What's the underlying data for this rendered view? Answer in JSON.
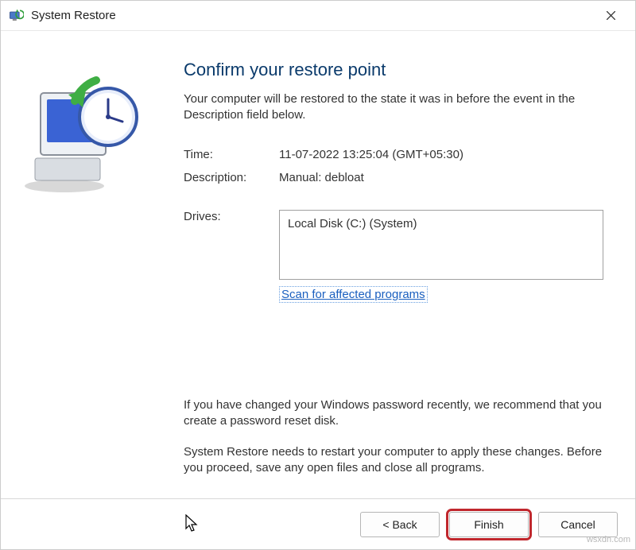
{
  "window": {
    "title": "System Restore"
  },
  "page": {
    "heading": "Confirm your restore point",
    "intro": "Your computer will be restored to the state it was in before the event in the Description field below."
  },
  "fields": {
    "time_label": "Time:",
    "time_value": "11-07-2022 13:25:04 (GMT+05:30)",
    "description_label": "Description:",
    "description_value": "Manual: debloat",
    "drives_label": "Drives:",
    "drives_value": "Local Disk (C:) (System)"
  },
  "links": {
    "scan": "Scan for affected programs"
  },
  "notes": {
    "password": "If you have changed your Windows password recently, we recommend that you create a password reset disk.",
    "restart": "System Restore needs to restart your computer to apply these changes. Before you proceed, save any open files and close all programs."
  },
  "buttons": {
    "back": "< Back",
    "finish": "Finish",
    "cancel": "Cancel"
  },
  "watermark": "wsxdn.com"
}
